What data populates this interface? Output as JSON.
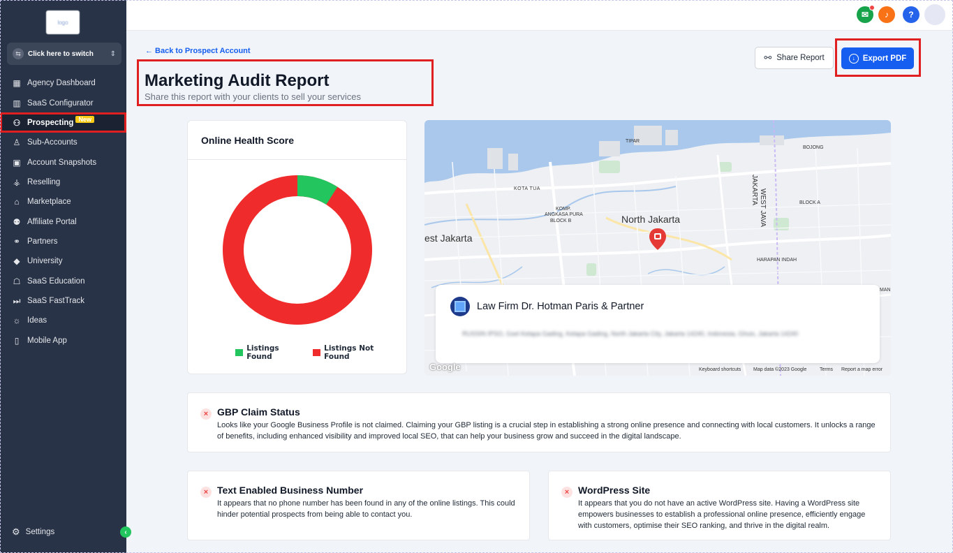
{
  "sidebar": {
    "logo_text": "logo",
    "switcher_label": "Click here to switch",
    "items": [
      {
        "label": "Agency Dashboard",
        "icon": "dashboard-icon"
      },
      {
        "label": "SaaS Configurator",
        "icon": "chart-icon"
      },
      {
        "label": "Prospecting",
        "icon": "users-icon",
        "badge": "New"
      },
      {
        "label": "Sub-Accounts",
        "icon": "user-icon"
      },
      {
        "label": "Account Snapshots",
        "icon": "snapshot-icon"
      },
      {
        "label": "Reselling",
        "icon": "reselling-icon"
      },
      {
        "label": "Marketplace",
        "icon": "bag-icon"
      },
      {
        "label": "Affiliate Portal",
        "icon": "affiliate-icon"
      },
      {
        "label": "Partners",
        "icon": "handshake-icon"
      },
      {
        "label": "University",
        "icon": "graduation-icon"
      },
      {
        "label": "SaaS Education",
        "icon": "education-icon"
      },
      {
        "label": "SaaS FastTrack",
        "icon": "fast-forward-icon"
      },
      {
        "label": "Ideas",
        "icon": "bulb-icon"
      },
      {
        "label": "Mobile App",
        "icon": "mobile-icon"
      }
    ],
    "settings_label": "Settings"
  },
  "header": {
    "back_link": "← Back to Prospect Account",
    "title": "Marketing Audit Report",
    "subtitle": "Share this report with your clients to sell your services",
    "share_label": "Share Report",
    "export_label": "Export PDF"
  },
  "health": {
    "title": "Online Health Score",
    "found_pct": 9,
    "legend_found": "Listings Found",
    "legend_not_found": "Listings Not Found",
    "color_found": "#22c55e",
    "color_not_found": "#ef2b2b"
  },
  "map": {
    "labels": {
      "north_jakarta": "North Jakarta",
      "west_jakarta": "est Jakarta",
      "kota_tua": "KOTA TUA",
      "komp": "KOMP.",
      "angkasa": "ANGKASA PURA",
      "blockb": "BLOCK B",
      "tipar": "TIPAR",
      "bojong": "BOJONG",
      "blocka": "BLOCK A",
      "westjava": "WEST JAVA",
      "jakarta": "JAKARTA",
      "harapan": "HARAPAN INDAH",
      "man": "MAN"
    },
    "business_name": "Law Firm Dr. Hotman Paris & Partner",
    "business_address": "RUSSIN IPSO, Gsel Kelapa Gading, Kelapa Gading, North Jakarta City, Jakarta 14240, Indonesia, Ghuis, Jakarta 14240",
    "footer": {
      "shortcuts": "Keyboard shortcuts",
      "data": "Map data ©2023 Google",
      "terms": "Terms",
      "report": "Report a map error",
      "google": "Google"
    }
  },
  "cards": {
    "gbp": {
      "title": "GBP Claim Status",
      "desc": "Looks like your Google Business Profile is not claimed. Claiming your GBP listing is a crucial step in establishing a strong online presence and connecting with local customers. It unlocks a range of benefits, including enhanced visibility and improved local SEO, that can help your business grow and succeed in the digital landscape."
    },
    "text_number": {
      "title": "Text Enabled Business Number",
      "desc": "It appears that no phone number has been found in any of the online listings. This could hinder potential prospects from being able to contact you."
    },
    "wordpress": {
      "title": "WordPress Site",
      "desc": "It appears that you do not have an active WordPress site. Having a WordPress site empowers businesses to establish a professional online presence, efficiently engage with customers, optimise their SEO ranking, and thrive in the digital realm."
    }
  },
  "topbar": {
    "icons": [
      "megaphone-icon",
      "bell-icon",
      "help-icon",
      "avatar"
    ],
    "help_glyph": "?"
  }
}
